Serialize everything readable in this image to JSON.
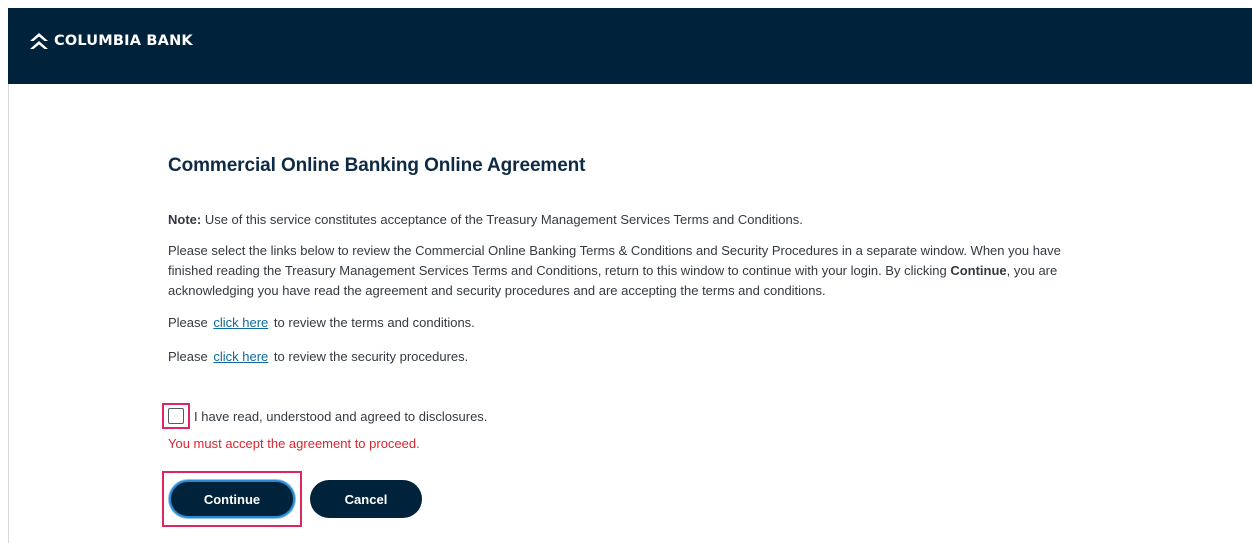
{
  "header": {
    "brand_name": "COLUMBIA BANK",
    "logo_icon": "chevron-up-logo-icon",
    "background_color": "#01223b"
  },
  "main": {
    "title": "Commercial Online Banking Online Agreement",
    "note_label": "Note:",
    "note_text": " Use of this service constitutes acceptance of the Treasury Management Services Terms and Conditions.",
    "paragraph_before": "Please select the links below to review the Commercial Online Banking Terms & Conditions and Security Procedures in a separate window. When you have finished reading the Treasury Management Services Terms and Conditions, return to this window to continue with your login. By clicking ",
    "paragraph_bold": "Continue",
    "paragraph_after": ", you are acknowledging you have read the agreement and security procedures and are accepting the terms and conditions.",
    "terms_line": {
      "prefix": "Please ",
      "link": "click here",
      "suffix": " to review the terms and conditions."
    },
    "security_line": {
      "prefix": "Please ",
      "link": "click here",
      "suffix": " to review the security procedures."
    },
    "checkbox_label": "I have read, understood and agreed to disclosures.",
    "checkbox_checked": false,
    "error_message": "You must accept the agreement to proceed.",
    "error_color": "#d8252f",
    "highlight_color": "#e0245e"
  },
  "actions": {
    "continue_label": "Continue",
    "cancel_label": "Cancel"
  }
}
